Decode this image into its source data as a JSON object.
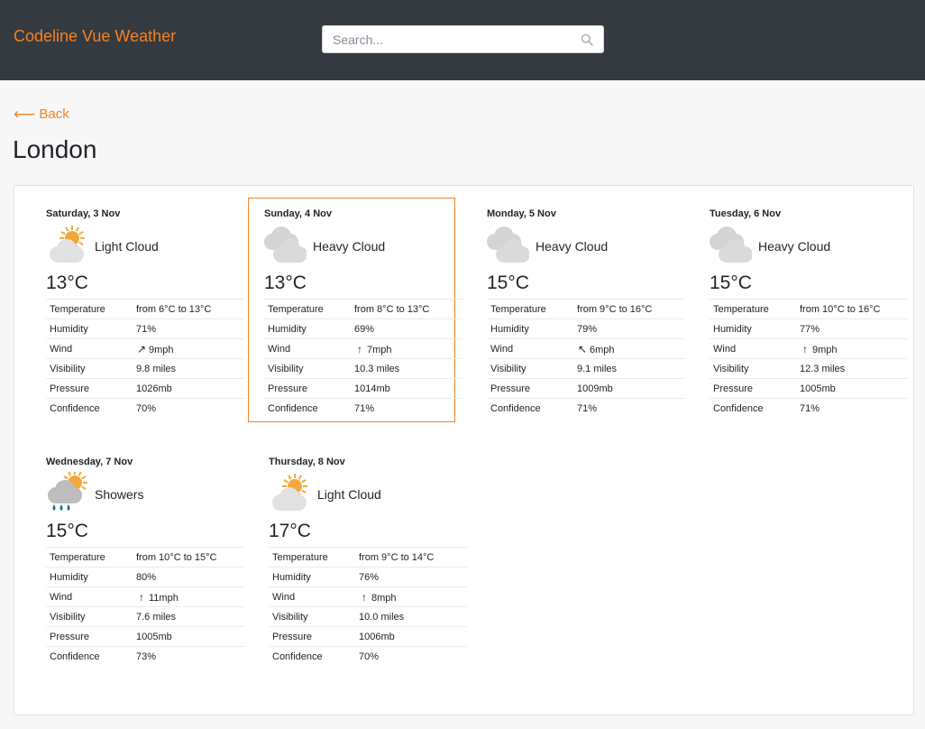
{
  "app": {
    "brand": "Codeline Vue Weather"
  },
  "search": {
    "placeholder": "Search..."
  },
  "nav": {
    "back_label": "Back",
    "back_arrow": "⟵"
  },
  "page": {
    "city": "London"
  },
  "colors": {
    "accent": "#f58220",
    "navbar": "#343a40",
    "rain": "#1c6e8c",
    "sun": "#f2a93b"
  },
  "stat_labels": [
    "Temperature",
    "Humidity",
    "Wind",
    "Visibility",
    "Pressure",
    "Confidence"
  ],
  "days": [
    {
      "date": "Saturday, 3 Nov",
      "summary": "Light Cloud",
      "icon": "light-cloud-icon",
      "temp": "13°C",
      "temperature": "from 6°C to 13°C",
      "humidity": "71%",
      "wind_arrow": "↗",
      "wind": "9mph",
      "visibility": "9.8 miles",
      "pressure": "1026mb",
      "confidence": "70%",
      "selected": false
    },
    {
      "date": "Sunday, 4 Nov",
      "summary": "Heavy Cloud",
      "icon": "heavy-cloud-icon",
      "temp": "13°C",
      "temperature": "from 8°C to 13°C",
      "humidity": "69%",
      "wind_arrow": "↑",
      "wind": "7mph",
      "visibility": "10.3 miles",
      "pressure": "1014mb",
      "confidence": "71%",
      "selected": true
    },
    {
      "date": "Monday, 5 Nov",
      "summary": "Heavy Cloud",
      "icon": "heavy-cloud-icon",
      "temp": "15°C",
      "temperature": "from 9°C to 16°C",
      "humidity": "79%",
      "wind_arrow": "↖",
      "wind": "6mph",
      "visibility": "9.1 miles",
      "pressure": "1009mb",
      "confidence": "71%",
      "selected": false
    },
    {
      "date": "Tuesday, 6 Nov",
      "summary": "Heavy Cloud",
      "icon": "heavy-cloud-icon",
      "temp": "15°C",
      "temperature": "from 10°C to 16°C",
      "humidity": "77%",
      "wind_arrow": "↑",
      "wind": "9mph",
      "visibility": "12.3 miles",
      "pressure": "1005mb",
      "confidence": "71%",
      "selected": false
    },
    {
      "date": "Wednesday, 7 Nov",
      "summary": "Showers",
      "icon": "showers-icon",
      "temp": "15°C",
      "temperature": "from 10°C to 15°C",
      "humidity": "80%",
      "wind_arrow": "↑",
      "wind": "11mph",
      "visibility": "7.6 miles",
      "pressure": "1005mb",
      "confidence": "73%",
      "selected": false
    },
    {
      "date": "Thursday, 8 Nov",
      "summary": "Light Cloud",
      "icon": "light-cloud-icon",
      "temp": "17°C",
      "temperature": "from 9°C to 14°C",
      "humidity": "76%",
      "wind_arrow": "↑",
      "wind": "8mph",
      "visibility": "10.0 miles",
      "pressure": "1006mb",
      "confidence": "70%",
      "selected": false
    }
  ]
}
